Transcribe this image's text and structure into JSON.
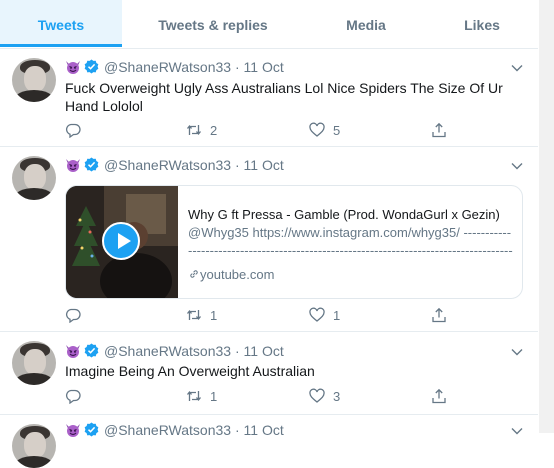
{
  "tabs": [
    "Tweets",
    "Tweets & replies",
    "Media",
    "Likes"
  ],
  "author": {
    "handle": "@ShaneRWatson33"
  },
  "tweets": [
    {
      "date": "· 11 Oct",
      "text": "Fuck Overweight Ugly Ass Australians Lol Nice Spiders The Size Of Ur Hand Lololol",
      "reply_count": "",
      "retweet_count": "2",
      "like_count": "5"
    },
    {
      "date": "· 11 Oct",
      "text": "",
      "card": {
        "title": "Why G ft Pressa - Gamble (Prod. WondaGurl x Gezin)",
        "description": "@Whyg35 https://www.instagram.com/whyg35/ ------------------------------------------------------------------------------------------------------------------------------------------------------------------------------------------------------------------------------------------------------------ ...",
        "domain": "youtube.com"
      },
      "reply_count": "",
      "retweet_count": "1",
      "like_count": "1"
    },
    {
      "date": "· 11 Oct",
      "text": "Imagine Being An Overweight Australian",
      "reply_count": "",
      "retweet_count": "1",
      "like_count": "3"
    },
    {
      "date": "· 11 Oct",
      "text": ""
    }
  ],
  "colors": {
    "accent": "#1da1f2",
    "muted": "#657786",
    "verified": "#1da1f2",
    "emoji": "#8a4baf"
  },
  "icons": [
    "smiling-devil-emoji-icon",
    "verified-badge-icon",
    "chevron-down-icon",
    "reply-icon",
    "retweet-icon",
    "like-icon",
    "share-icon",
    "link-icon",
    "play-icon"
  ]
}
